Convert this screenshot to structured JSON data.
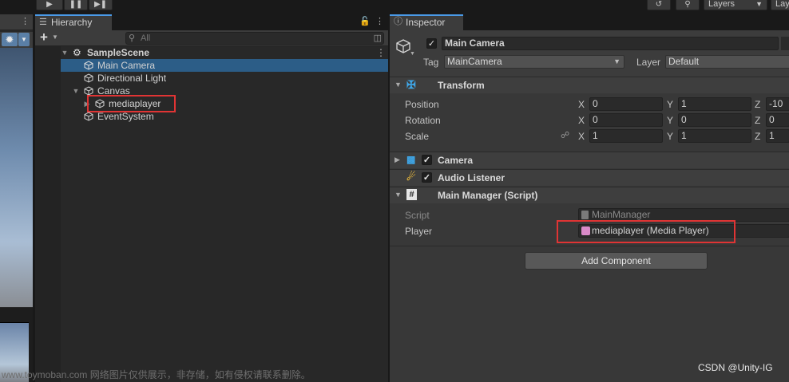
{
  "toolbar": {
    "layers_label": "Layers",
    "layout_label": "Lay"
  },
  "hierarchy": {
    "tab_label": "Hierarchy",
    "search_placeholder": "All",
    "scene_name": "SampleScene",
    "items": [
      {
        "label": "Main Camera"
      },
      {
        "label": "Directional Light"
      },
      {
        "label": "Canvas"
      },
      {
        "label": "mediaplayer"
      },
      {
        "label": "EventSystem"
      }
    ]
  },
  "inspector": {
    "tab_label": "Inspector",
    "object_name": "Main Camera",
    "tag_label": "Tag",
    "tag_value": "MainCamera",
    "layer_label": "Layer",
    "layer_value": "Default",
    "transform": {
      "title": "Transform",
      "rows": [
        {
          "label": "Position",
          "x": "0",
          "y": "1",
          "z": "-10"
        },
        {
          "label": "Rotation",
          "x": "0",
          "y": "0",
          "z": "0"
        },
        {
          "label": "Scale",
          "x": "1",
          "y": "1",
          "z": "1"
        }
      ],
      "axis_x": "X",
      "axis_y": "Y",
      "axis_z": "Z"
    },
    "camera_title": "Camera",
    "audio_title": "Audio Listener",
    "script_component": {
      "title": "Main Manager (Script)",
      "script_label": "Script",
      "script_value": "MainManager",
      "player_label": "Player",
      "player_value": "mediaplayer (Media Player)"
    },
    "add_component_label": "Add Component"
  },
  "watermark": {
    "left": "www.toymoban.com 网络图片仅供展示，非存储，如有侵权请联系删除。",
    "right": "CSDN @Unity-IG"
  },
  "colors": {
    "selection": "#2c5d87",
    "highlight_box": "#e03434",
    "tab_accent": "#4a9ae8"
  }
}
